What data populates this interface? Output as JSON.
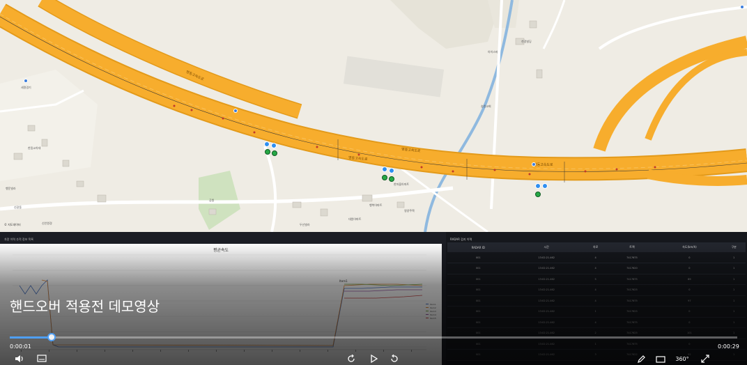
{
  "map": {
    "road_labels": [
      "영동고속도로",
      "영동고속도로",
      "영동고속도로",
      "영동고속도로"
    ],
    "place_labels": [
      "세명경기",
      "한림교차대",
      "행운빌라",
      "신갈동",
      "공원",
      "행복아파트",
      "아이스마",
      "천경빌딩",
      "송원교회",
      "한마을아파트",
      "대원아파트",
      "신안원경",
      "두산빌라",
      "영양주택"
    ],
    "logo_text": "© 지도데이터"
  },
  "chart_panel": {
    "header": "차량 이력 추적 정보 목록",
    "title": "평균속도",
    "legend": [
      "Item1",
      "Item2",
      "Item3",
      "Item4",
      "Item5"
    ],
    "point_label": "Item1",
    "colors": [
      "#4c78c8",
      "#e08a3c",
      "#7aa84a",
      "#9a5aa8",
      "#c94a4a"
    ]
  },
  "table_panel": {
    "header": "RADAR 검지 이력",
    "columns": [
      "RADAR ID",
      "시간",
      "차로",
      "트랙",
      "속도(km/h)",
      "구분"
    ],
    "rows": [
      [
        "001",
        "13:02:21.462",
        "4",
        "7417675",
        "0",
        "1"
      ],
      [
        "001",
        "13:02:21.462",
        "4",
        "7417620",
        "0",
        "1"
      ],
      [
        "001",
        "13:02:21.462",
        "5",
        "7417675",
        "89",
        "1"
      ],
      [
        "001",
        "13:02:21.462",
        "4",
        "7417625",
        "0",
        "1"
      ],
      [
        "001",
        "13:02:21.462",
        "4",
        "7417675",
        "97",
        "1"
      ],
      [
        "001",
        "13:02:21.462",
        "1",
        "7417625",
        "0",
        "1"
      ],
      [
        "001",
        "13:02:21.462",
        "4",
        "7417675",
        "0",
        "1"
      ],
      [
        "001",
        "13:02:21.462",
        "2",
        "7417625",
        "101",
        "1"
      ],
      [
        "001",
        "13:02:21.462",
        "1",
        "7417675",
        "0",
        "1"
      ],
      [
        "001",
        "13:02:21.462",
        "3",
        "7417622",
        "92",
        "1"
      ]
    ]
  },
  "player": {
    "title": "핸드오버 적용전 데모영상",
    "time_current": "0:00:01",
    "time_total": "0:00:29",
    "progress": 0.057,
    "accent": "#4f9ff5",
    "icons": [
      "volume-icon",
      "subtitles-icon",
      "rewind-icon",
      "play-icon",
      "forward-icon",
      "edit-icon",
      "screen-icon",
      "vr360-icon",
      "fullscreen-icon"
    ],
    "vr_label": "360°"
  }
}
